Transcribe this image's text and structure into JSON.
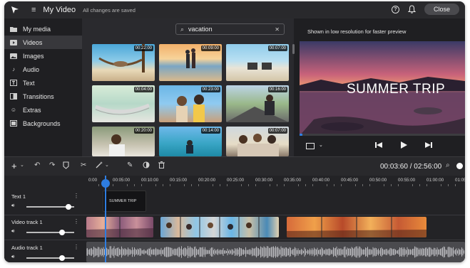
{
  "app": {
    "project_title": "My Video",
    "save_status": "All changes are saved",
    "close_label": "Close"
  },
  "sidebar": {
    "items": [
      {
        "label": "My media",
        "icon": "folder-icon"
      },
      {
        "label": "Videos",
        "icon": "video-icon"
      },
      {
        "label": "Images",
        "icon": "image-icon"
      },
      {
        "label": "Audio",
        "icon": "music-note-icon"
      },
      {
        "label": "Text",
        "icon": "text-icon"
      },
      {
        "label": "Transitions",
        "icon": "transitions-icon"
      },
      {
        "label": "Extras",
        "icon": "smiley-icon"
      },
      {
        "label": "Backgrounds",
        "icon": "backgrounds-icon"
      }
    ],
    "active": "Videos"
  },
  "library": {
    "search_value": "vacation",
    "durations": [
      "00:22:00",
      "00:09:00",
      "00:07:00",
      "00:04:00",
      "00:23:00",
      "00:16:00",
      "00:20:00",
      "00:14:00",
      "00:07:00"
    ]
  },
  "preview": {
    "note": "Shown in low resolution for faster preview",
    "title_overlay": "SUMMER TRIP"
  },
  "toolbar": {
    "timecode": "00:03:60 / 02:56:00"
  },
  "timeline": {
    "ruler_labels": [
      "0:00",
      "00:05:00",
      "00:10:00",
      "00:15:00",
      "00:20:00",
      "00:25:00",
      "00:30:00",
      "00:35:00",
      "00:40:00",
      "00:45:00",
      "00:50:00",
      "00:55:00",
      "01:00:00",
      "01:05:00"
    ],
    "tracks": [
      {
        "name": "Text 1",
        "volume": 0.88
      },
      {
        "name": "Video track 1",
        "volume": 0.75
      },
      {
        "name": "Audio track 1",
        "volume": 0.75
      }
    ],
    "text_clip_label": "SUMMER TRIP"
  },
  "colors": {
    "accent": "#2e7de0",
    "background": "#1f1f22"
  }
}
